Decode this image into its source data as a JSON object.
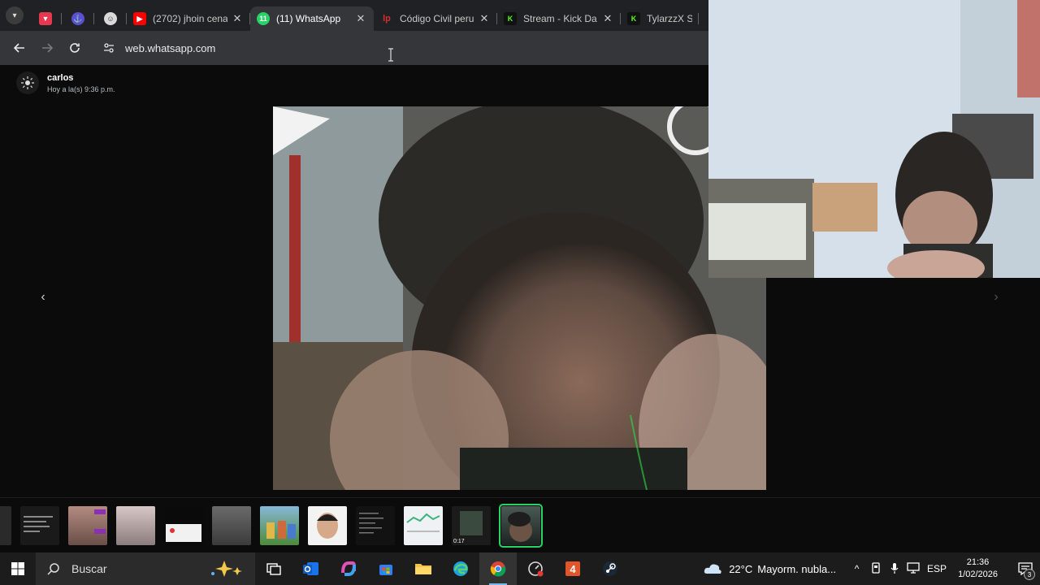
{
  "browser": {
    "tabs": [
      {
        "title": "",
        "favicon": "tv-app-icon",
        "color": "#e8384f",
        "pinned": true
      },
      {
        "title": "",
        "favicon": "anchor-app-icon",
        "color": "#5a4fcf",
        "pinned": true
      },
      {
        "title": "",
        "favicon": "character-icon",
        "color": "#d9d9d9",
        "pinned": true
      },
      {
        "title": "(2702) jhoin cena",
        "favicon": "youtube-icon",
        "color": "#ff0000",
        "pinned": false,
        "active": false
      },
      {
        "title": "(11) WhatsApp",
        "favicon": "whatsapp-icon",
        "color": "#25d366",
        "pinned": false,
        "active": true
      },
      {
        "title": "Código Civil peru",
        "favicon": "lp-icon",
        "color": "#d32f2f",
        "pinned": false,
        "active": false
      },
      {
        "title": "Stream - Kick Da",
        "favicon": "kick-icon",
        "color": "#53fc18",
        "pinned": false,
        "active": false
      },
      {
        "title": "TylarzzX Strea",
        "favicon": "kick-icon",
        "color": "#53fc18",
        "pinned": false,
        "active": false
      }
    ],
    "url": "web.whatsapp.com"
  },
  "viewer": {
    "sender_name": "carlos",
    "sender_time": "Hoy a la(s) 9:36 p.m.",
    "thumbnails": [
      {
        "kind": "video"
      },
      {
        "kind": "text"
      },
      {
        "kind": "face"
      },
      {
        "kind": "face"
      },
      {
        "kind": "doc"
      },
      {
        "kind": "photo"
      },
      {
        "kind": "cartoon"
      },
      {
        "kind": "face"
      },
      {
        "kind": "dark"
      },
      {
        "kind": "doc"
      },
      {
        "kind": "video",
        "duration": "0:17"
      },
      {
        "kind": "face",
        "active": true
      }
    ]
  },
  "taskbar": {
    "search_label": "Buscar",
    "temperature": "22°C",
    "weather_text": "Mayorm. nubla...",
    "language": "ESP",
    "time": "21:36",
    "date": "1/02/2026",
    "notification_count": "3"
  }
}
